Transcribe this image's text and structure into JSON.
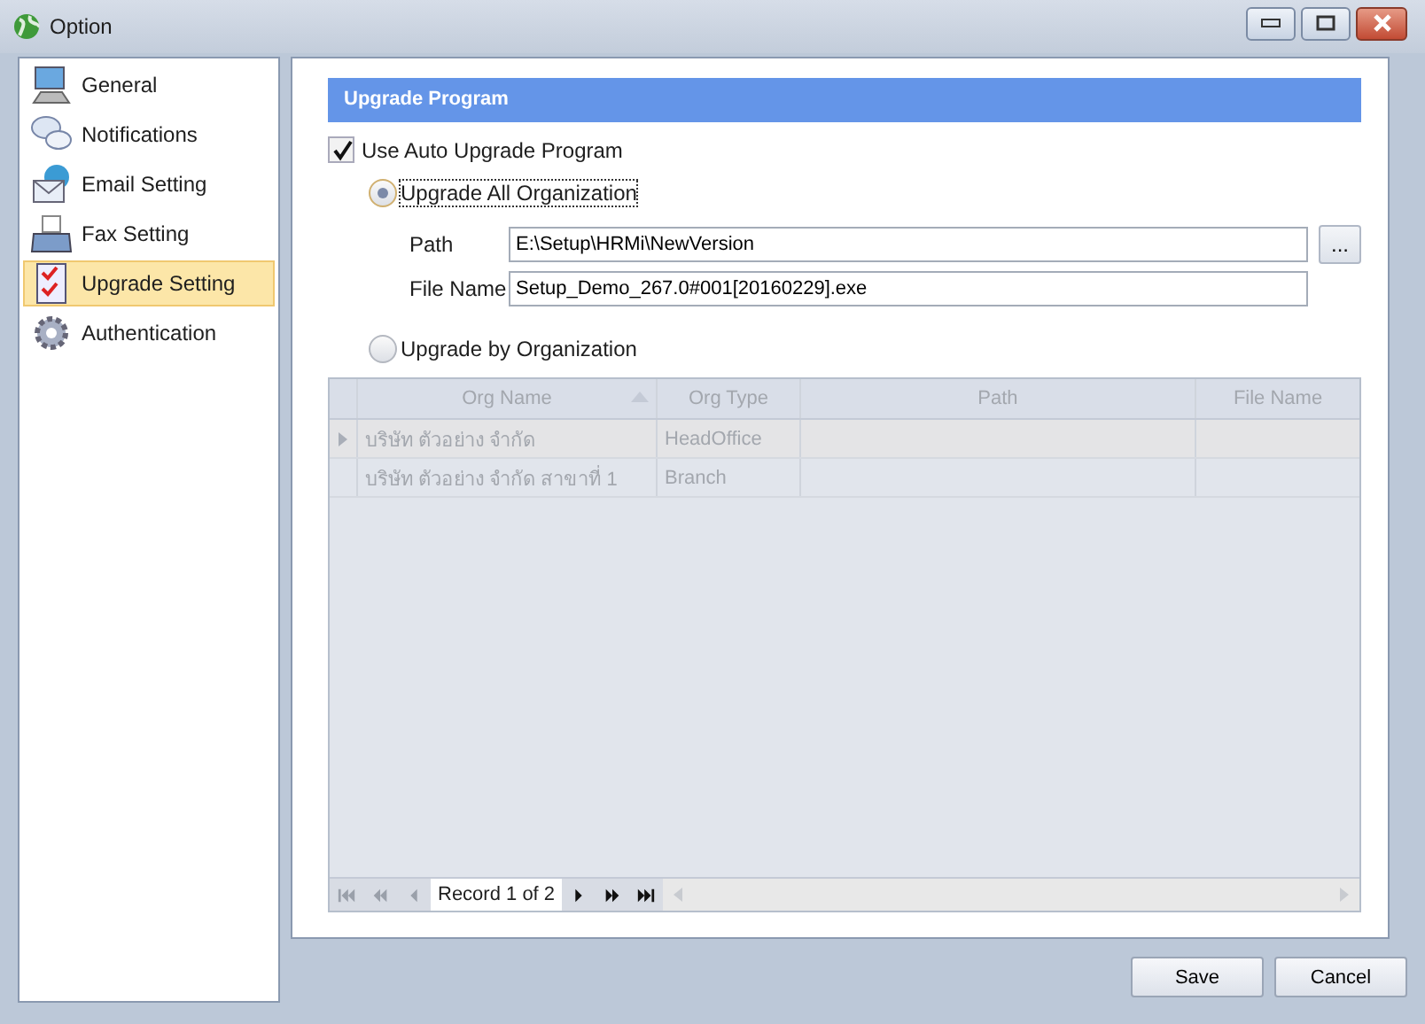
{
  "window": {
    "title": "Option"
  },
  "sidebar": {
    "items": [
      {
        "label": "General",
        "kind": "computer",
        "selected": false
      },
      {
        "label": "Notifications",
        "kind": "chat",
        "selected": false
      },
      {
        "label": "Email Setting",
        "kind": "email",
        "selected": false
      },
      {
        "label": "Fax Setting",
        "kind": "fax",
        "selected": false
      },
      {
        "label": "Upgrade Setting",
        "kind": "checklist",
        "selected": true
      },
      {
        "label": "Authentication",
        "kind": "gear",
        "selected": false
      }
    ]
  },
  "section": {
    "title": "Upgrade Program"
  },
  "auto_upgrade": {
    "label": "Use Auto Upgrade Program",
    "checked": true
  },
  "options": [
    {
      "label": "Upgrade All Organization",
      "selected": true
    },
    {
      "label": "Upgrade by Organization",
      "selected": false
    }
  ],
  "fields": [
    {
      "label": "Path",
      "value": "E:\\Setup\\HRMi\\NewVersion",
      "browse": "..."
    },
    {
      "label": "File Name",
      "value": "Setup_Demo_267.0#001[20160229].exe"
    }
  ],
  "table": {
    "disabled": true,
    "columns": [
      "Org Name",
      "Org Type",
      "Path",
      "File Name"
    ],
    "rows": [
      {
        "cells": [
          "บริษัท ตัวอย่าง จำกัด",
          "HeadOffice",
          "",
          ""
        ],
        "selected": true
      },
      {
        "cells": [
          "บริษัท ตัวอย่าง จำกัด สาขาที่ 1",
          "Branch",
          "",
          ""
        ],
        "selected": false
      }
    ],
    "navigator": {
      "record": "Record 1 of 2",
      "buttons": [
        {
          "kind": "first",
          "disabled": true
        },
        {
          "kind": "prev-page",
          "disabled": true
        },
        {
          "kind": "prev",
          "disabled": true
        },
        {
          "kind": "next",
          "disabled": false
        },
        {
          "kind": "next-page",
          "disabled": false
        },
        {
          "kind": "last",
          "disabled": false
        }
      ]
    }
  },
  "buttons": [
    "Save",
    "Cancel"
  ]
}
